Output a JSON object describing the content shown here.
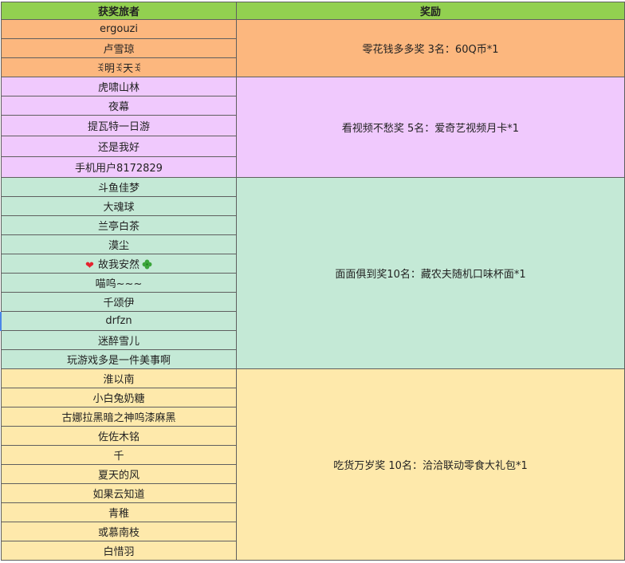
{
  "header": {
    "winner_col": "获奖旅者",
    "prize_col": "奖励"
  },
  "groups": [
    {
      "prize": "零花钱多多奖 3名：60Q币*1",
      "color": "#fcb77e",
      "winners": [
        "ergouzi",
        "卢雪琼",
        "ꉂ明ꉂ天ꉂ"
      ]
    },
    {
      "prize": "看视频不愁奖 5名：爱奇艺视频月卡*1",
      "color": "#f0c9fd",
      "winners": [
        "虎啸山林",
        "夜幕",
        "提瓦特一日游",
        "还是我好",
        "手机用户8172829"
      ]
    },
    {
      "prize": "面面俱到奖10名：藏农夫随机口味杯面*1",
      "color": "#c4e9d6",
      "winners": [
        "斗鱼佳梦",
        "大魂球",
        "兰亭白茶",
        "漠尘",
        "故我安然",
        "喵呜~~~",
        "千颂伊",
        "drfzn",
        "迷醉雪儿",
        "玩游戏多是一件美事啊"
      ]
    },
    {
      "prize": "吃货万岁奖 10名：洽洽联动零食大礼包*1",
      "color": "#fee9ab",
      "winners": [
        "淮以南",
        "小白兔奶糖",
        "古娜拉黑暗之神呜漆麻黑",
        "佐佐木铭",
        "千",
        "夏天的风",
        "如果云知道",
        "青稚",
        "或慕南枝",
        "白惜羽"
      ]
    }
  ],
  "decorations": {
    "heart_icon": "heart-icon",
    "clover_icon": "four-leaf-clover-icon",
    "selection_color": "#4a86e8"
  }
}
